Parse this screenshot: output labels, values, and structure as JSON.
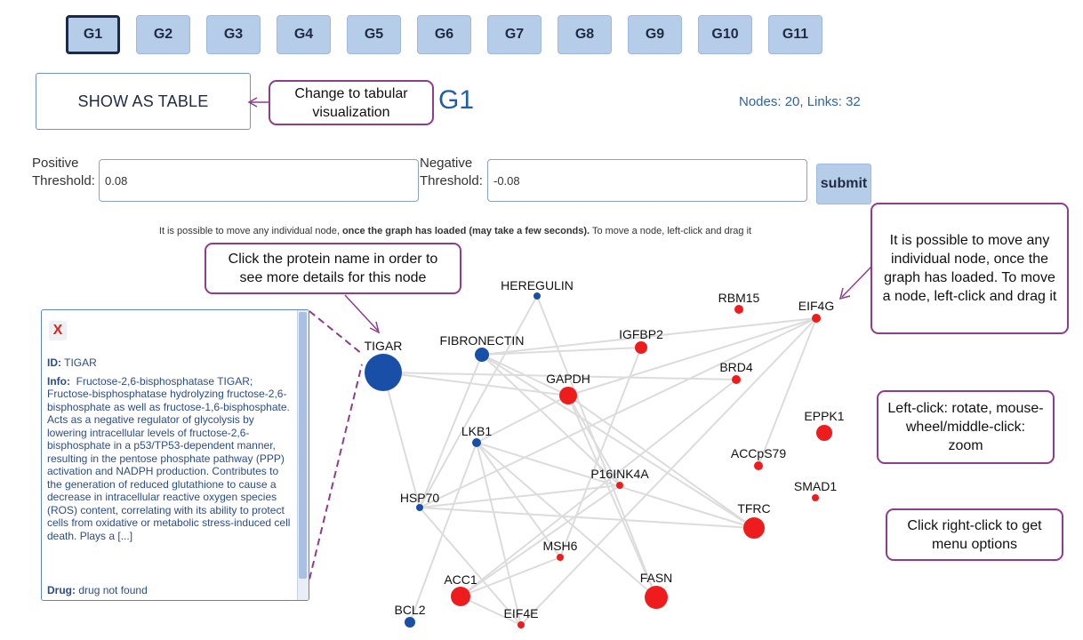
{
  "tabs": [
    "G1",
    "G2",
    "G3",
    "G4",
    "G5",
    "G6",
    "G7",
    "G8",
    "G9",
    "G10",
    "G11"
  ],
  "active_tab": "G1",
  "show_table_label": "SHOW AS TABLE",
  "graph_title": "G1",
  "stats": "Nodes: 20, Links: 32",
  "thresholds": {
    "positive_label_1": "Positive",
    "positive_label_2": "Threshold:",
    "positive_value": "0.08",
    "negative_label_1": "Negative",
    "negative_label_2": "Threshold:",
    "negative_value": "-0.08",
    "submit_label": "submit"
  },
  "hint": {
    "part1": "It is possible to move any individual node, ",
    "bold": "once the graph has loaded (may take a few seconds).",
    "part2": " To move a node, left-click and drag it"
  },
  "callouts": {
    "table": "Change to tabular visualization",
    "protein": "Click the protein name in order to see more details for this node",
    "move": "It is possible to move any individual node, once the graph has loaded. To move a node, left-click and drag it",
    "zoom": "Left-click: rotate, mouse-wheel/middle-click: zoom",
    "menu": "Click right-click to get menu options"
  },
  "detail_panel": {
    "close": "X",
    "id_label": "ID:",
    "id_value": "TIGAR",
    "info_label": "Info:",
    "info_text": "Fructose-2,6-bisphosphatase TIGAR; Fructose-bisphosphatase hydrolyzing fructose-2,6- bisphosphate as well as fructose-1,6-bisphosphate. Acts as a negative regulator of glycolysis by lowering intracellular levels of fructose-2,6-bisphosphate in a p53/TP53-dependent manner, resulting in the pentose phosphate pathway (PPP) activation and NADPH production. Contributes to the generation of reduced glutathione to cause a decrease in intracellular reactive oxygen species (ROS) content, correlating with its ability to protect cells from oxidative or metabolic stress-induced cell death. Plays a [...]",
    "drug_label": "Drug:",
    "drug_value": "drug not found"
  },
  "colors": {
    "positive_node": "#ee1c1c",
    "negative_node": "#1a4fa8",
    "link": "#dcdcdc",
    "callout_border": "#8e3d8e"
  },
  "nodes": [
    {
      "id": "HEREGULIN",
      "kind": "negative"
    },
    {
      "id": "RBM15",
      "kind": "positive"
    },
    {
      "id": "EIF4G",
      "kind": "positive"
    },
    {
      "id": "TIGAR",
      "kind": "negative"
    },
    {
      "id": "FIBRONECTIN",
      "kind": "negative"
    },
    {
      "id": "IGFBP2",
      "kind": "positive"
    },
    {
      "id": "GAPDH",
      "kind": "positive"
    },
    {
      "id": "BRD4",
      "kind": "positive"
    },
    {
      "id": "EPPK1",
      "kind": "positive"
    },
    {
      "id": "LKB1",
      "kind": "negative"
    },
    {
      "id": "ACCpS79",
      "kind": "positive"
    },
    {
      "id": "P16INK4A",
      "kind": "positive"
    },
    {
      "id": "SMAD1",
      "kind": "positive"
    },
    {
      "id": "HSP70",
      "kind": "negative"
    },
    {
      "id": "TFRC",
      "kind": "positive"
    },
    {
      "id": "MSH6",
      "kind": "positive"
    },
    {
      "id": "ACC1",
      "kind": "positive"
    },
    {
      "id": "FASN",
      "kind": "positive"
    },
    {
      "id": "BCL2",
      "kind": "negative"
    },
    {
      "id": "EIF4E",
      "kind": "positive"
    }
  ],
  "links": [
    [
      "TIGAR",
      "GAPDH"
    ],
    [
      "TIGAR",
      "BRD4"
    ],
    [
      "TIGAR",
      "HSP70"
    ],
    [
      "HEREGULIN",
      "HSP70"
    ],
    [
      "HEREGULIN",
      "FASN"
    ],
    [
      "FIBRONECTIN",
      "GAPDH"
    ],
    [
      "FIBRONECTIN",
      "IGFBP2"
    ],
    [
      "FIBRONECTIN",
      "EIF4G"
    ],
    [
      "FIBRONECTIN",
      "P16INK4A"
    ],
    [
      "FIBRONECTIN",
      "TFRC"
    ],
    [
      "FIBRONECTIN",
      "HSP70"
    ],
    [
      "GAPDH",
      "EIF4G"
    ],
    [
      "GAPDH",
      "LKB1"
    ],
    [
      "GAPDH",
      "FASN"
    ],
    [
      "GAPDH",
      "P16INK4A"
    ],
    [
      "GAPDH",
      "TFRC"
    ],
    [
      "IGFBP2",
      "MSH6"
    ],
    [
      "EIF4G",
      "HSP70"
    ],
    [
      "EIF4G",
      "EIF4E"
    ],
    [
      "EIF4G",
      "ACCpS79"
    ],
    [
      "BRD4",
      "ACC1"
    ],
    [
      "LKB1",
      "FASN"
    ],
    [
      "LKB1",
      "TFRC"
    ],
    [
      "LKB1",
      "MSH6"
    ],
    [
      "LKB1",
      "EIF4E"
    ],
    [
      "LKB1",
      "BCL2"
    ],
    [
      "HSP70",
      "P16INK4A"
    ],
    [
      "HSP70",
      "TFRC"
    ],
    [
      "HSP70",
      "EIF4E"
    ],
    [
      "P16INK4A",
      "ACC1"
    ],
    [
      "EIF4E",
      "ACC1"
    ],
    [
      "MSH6",
      "ACC1"
    ]
  ]
}
